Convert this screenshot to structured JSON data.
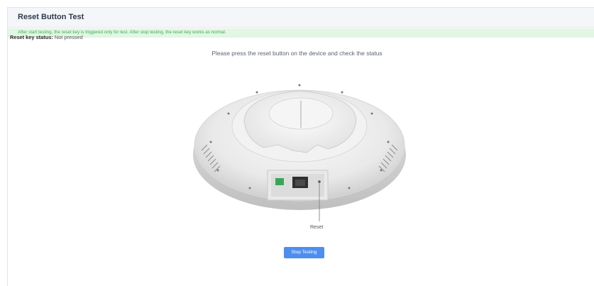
{
  "header": {
    "title": "Reset Button Test"
  },
  "notice": {
    "text": "After start testing, the reset key is triggered only for test. After stop testing, the reset key works as normal."
  },
  "status": {
    "label": "Reset key status:",
    "value": "Not pressed"
  },
  "instruction": "Please press the reset button on the device and check the status",
  "device": {
    "reset_callout": "Reset",
    "image_name": "access-point-bottom-view"
  },
  "actions": {
    "stop_label": "Stop Testing"
  },
  "colors": {
    "accent": "#4d8ef0",
    "notice_bg": "#e1f6e3",
    "notice_text": "#3fae5a",
    "header_bg": "#f4f6f9"
  }
}
